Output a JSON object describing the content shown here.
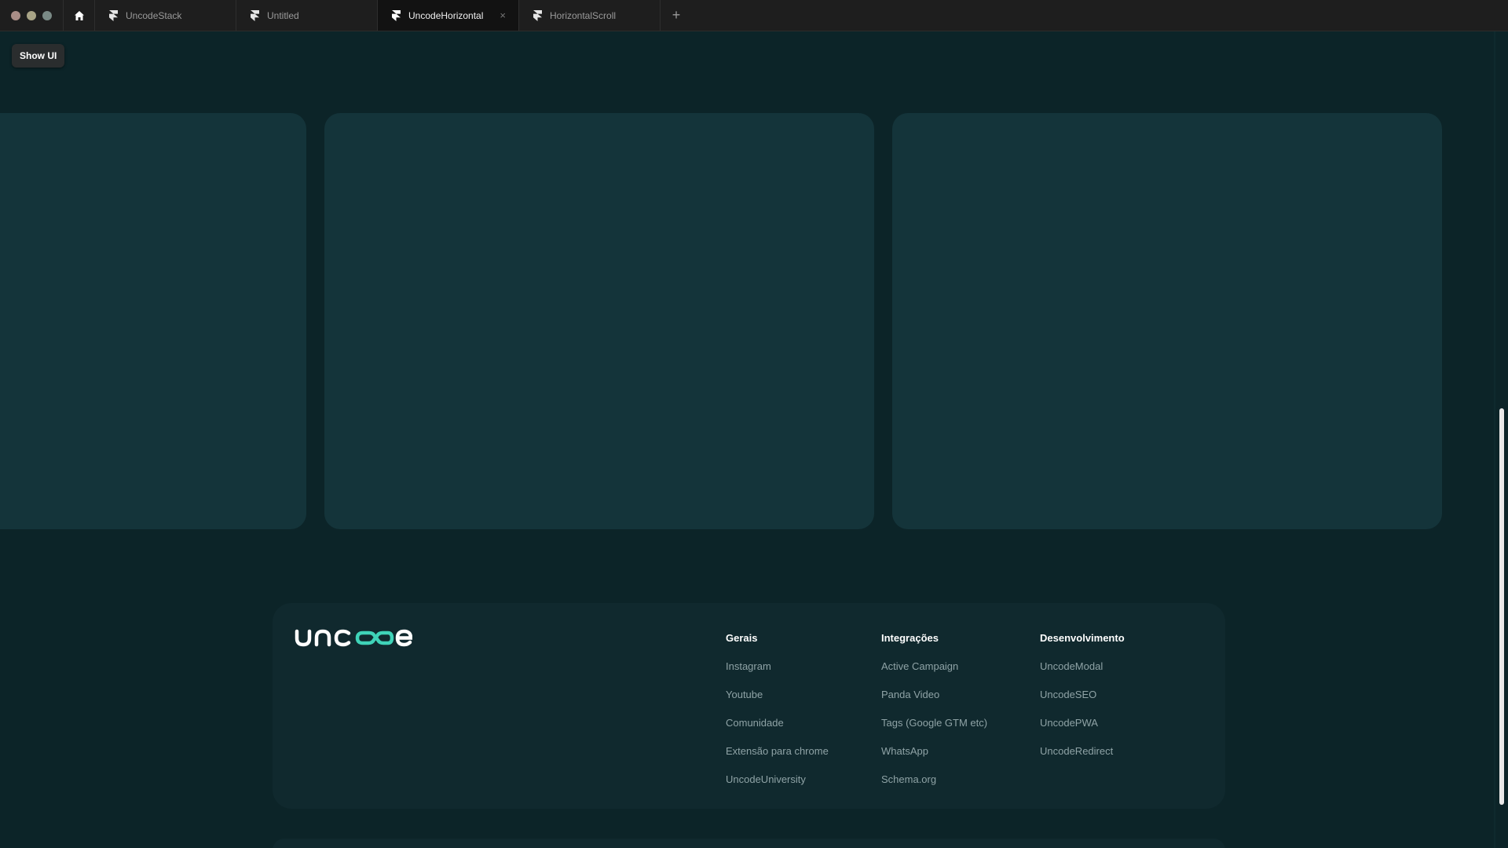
{
  "tabs": [
    {
      "label": "UncodeStack",
      "active": false
    },
    {
      "label": "Untitled",
      "active": false
    },
    {
      "label": "UncodeHorizontal",
      "active": true
    },
    {
      "label": "HorizontalScroll",
      "active": false
    }
  ],
  "tab_close": "×",
  "new_tab": "+",
  "show_ui_label": "Show UI",
  "footer": {
    "logo_text": "uncode",
    "columns": [
      {
        "title": "Gerais",
        "links": [
          "Instagram",
          "Youtube",
          "Comunidade",
          "Extensão para chrome",
          "UncodeUniversity"
        ]
      },
      {
        "title": "Integrações",
        "links": [
          "Active Campaign",
          "Panda Video",
          "Tags (Google GTM etc)",
          "WhatsApp",
          "Schema.org"
        ]
      },
      {
        "title": "Desenvolvimento",
        "links": [
          "UncodeModal",
          "UncodeSEO",
          "UncodePWA",
          "UncodeRedirect"
        ]
      }
    ]
  },
  "colors": {
    "accent": "#3fd3b8",
    "background": "#0c2428",
    "card": "#14343a",
    "footer": "#10292e"
  }
}
